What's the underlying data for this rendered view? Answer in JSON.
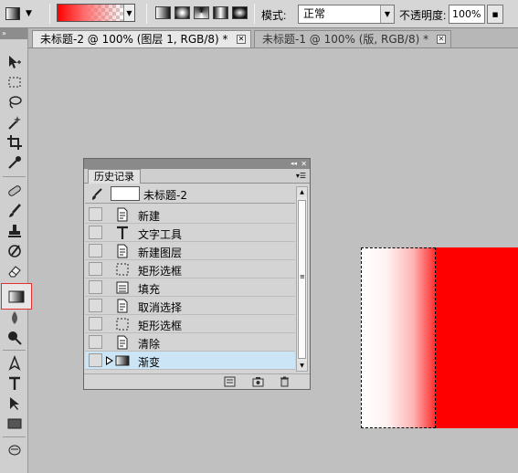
{
  "options_bar": {
    "mode_label": "模式:",
    "mode_value": "正常",
    "opacity_label": "不透明度:",
    "opacity_value": "100%",
    "gradient_colors": [
      "#ff0000",
      "#ffffff"
    ]
  },
  "tabs": [
    {
      "title": "未标题-2 @ 100% (图层 1, RGB/8) *",
      "active": true
    },
    {
      "title": "未标题-1 @ 100% (版, RGB/8) *",
      "active": false
    }
  ],
  "toolbox": {
    "selected_tool": "gradient-tool",
    "tools": [
      "move-tool",
      "marquee-tool",
      "lasso-tool",
      "magic-wand-tool",
      "crop-tool",
      "eyedropper-tool",
      "healing-brush-tool",
      "brush-tool",
      "clone-stamp-tool",
      "history-brush-tool",
      "eraser-tool",
      "gradient-tool",
      "blur-tool",
      "dodge-tool",
      "pen-tool",
      "type-tool",
      "path-selection-tool",
      "rectangle-tool",
      "hand-tool"
    ]
  },
  "history_panel": {
    "tab_label": "历史记录",
    "snapshot_name": "未标题-2",
    "states": [
      {
        "label": "新建",
        "icon": "document-icon"
      },
      {
        "label": "文字工具",
        "icon": "type-icon"
      },
      {
        "label": "新建图层",
        "icon": "document-icon"
      },
      {
        "label": "矩形选框",
        "icon": "marquee-icon"
      },
      {
        "label": "填充",
        "icon": "fill-icon"
      },
      {
        "label": "取消选择",
        "icon": "document-icon"
      },
      {
        "label": "矩形选框",
        "icon": "marquee-icon"
      },
      {
        "label": "清除",
        "icon": "document-icon"
      },
      {
        "label": "渐变",
        "icon": "gradient-icon",
        "selected": true
      }
    ]
  },
  "colors": {
    "accent_selection": "#cbe5f6",
    "canvas_red": "#ff0000",
    "tool_highlight": "#e03030"
  }
}
